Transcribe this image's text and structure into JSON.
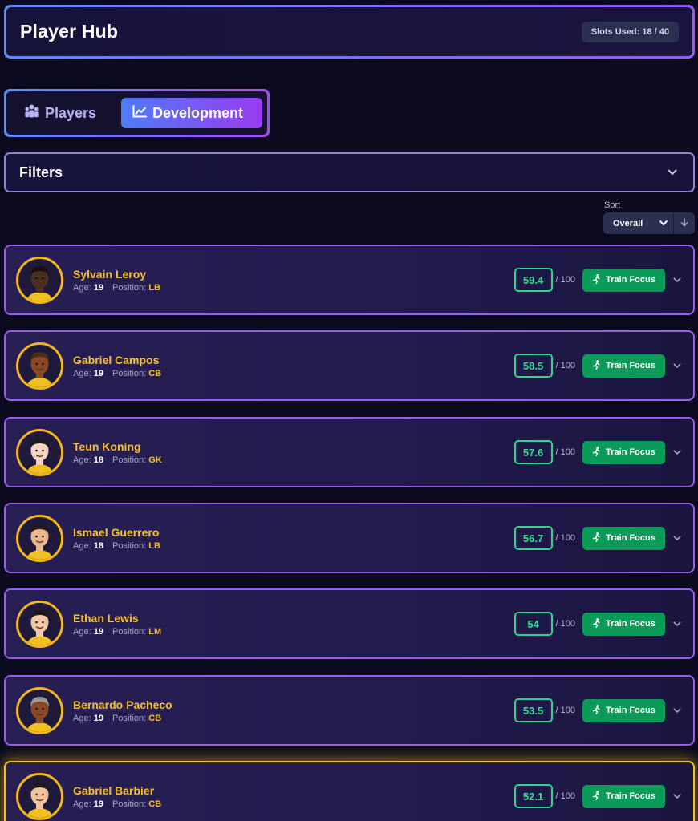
{
  "header": {
    "title": "Player Hub",
    "slots": "Slots Used: 18 / 40"
  },
  "tabs": [
    {
      "label": "Players",
      "icon": "people-icon",
      "active": false
    },
    {
      "label": "Development",
      "icon": "chart-line-icon",
      "active": true
    }
  ],
  "filters": {
    "label": "Filters"
  },
  "sort": {
    "label": "Sort",
    "value": "Overall",
    "direction": "descending"
  },
  "labels": {
    "age": "Age:",
    "position": "Position:",
    "out_of": "/ 100",
    "train": "Train Focus"
  },
  "colors": {
    "accent_gold": "#f6c22a",
    "score_green": "#34d98f",
    "train_button": "#0c9a58",
    "card_border": "#9b5cf0",
    "highlight_border": "#f3c418"
  },
  "players": [
    {
      "name": "Sylvain Leroy",
      "age": "19",
      "position": "LB",
      "score": "59.4",
      "skin": "#4a3020",
      "hair": "#1a1010",
      "highlight": false
    },
    {
      "name": "Gabriel Campos",
      "age": "19",
      "position": "CB",
      "score": "58.5",
      "skin": "#8a4a25",
      "hair": "#4a3018",
      "highlight": false
    },
    {
      "name": "Teun Koning",
      "age": "18",
      "position": "GK",
      "score": "57.6",
      "skin": "#f6d6c2",
      "hair": "#1e1a1a",
      "highlight": false
    },
    {
      "name": "Ismael Guerrero",
      "age": "18",
      "position": "LB",
      "score": "56.7",
      "skin": "#edb78c",
      "hair": "#1e1a1a",
      "highlight": false
    },
    {
      "name": "Ethan Lewis",
      "age": "19",
      "position": "LM",
      "score": "54",
      "skin": "#f2c8a6",
      "hair": "#1e1a1a",
      "highlight": false
    },
    {
      "name": "Bernardo Pacheco",
      "age": "19",
      "position": "CB",
      "score": "53.5",
      "skin": "#8a4a25",
      "hair": "#9a9a9a",
      "highlight": false
    },
    {
      "name": "Gabriel Barbier",
      "age": "19",
      "position": "CB",
      "score": "52.1",
      "skin": "#f0c29e",
      "hair": "#1e1a1a",
      "highlight": true
    }
  ]
}
